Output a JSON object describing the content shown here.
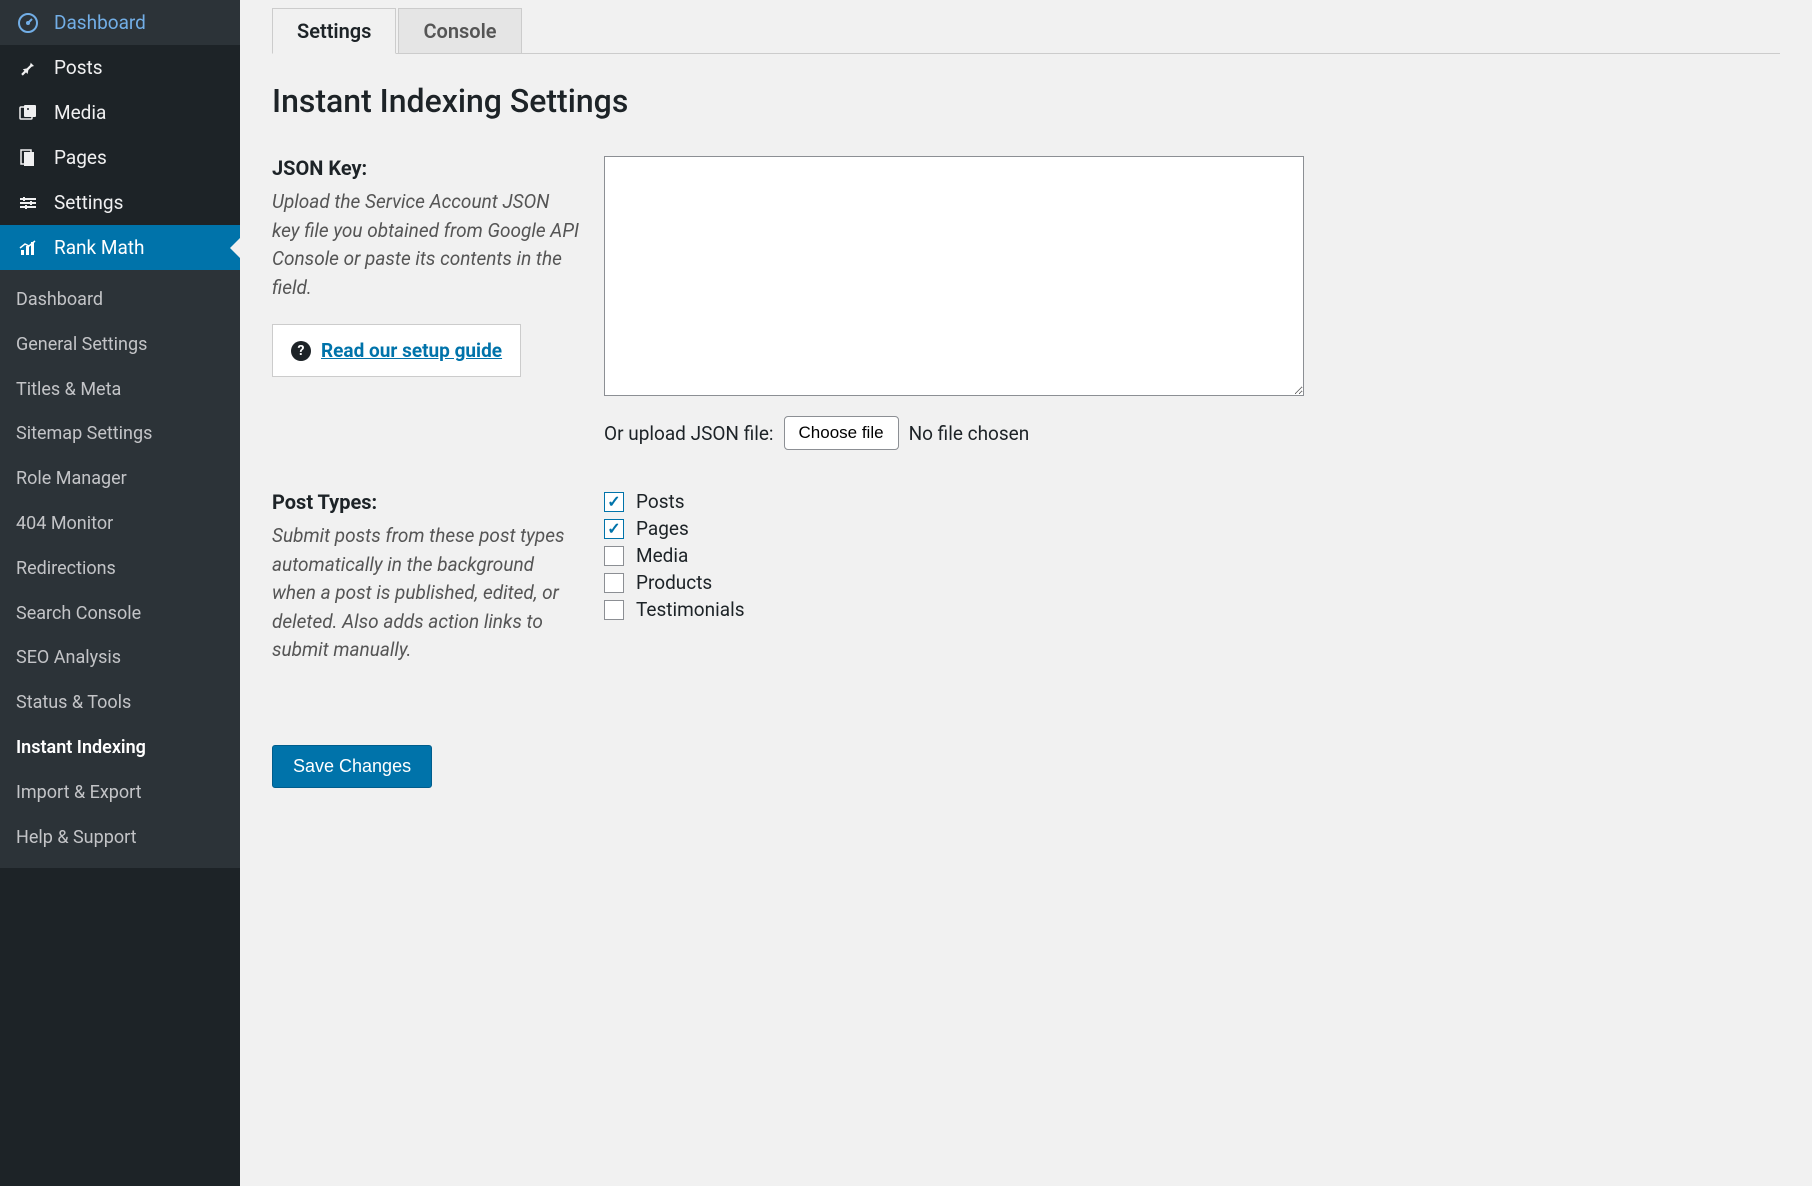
{
  "sidebar": {
    "items": [
      {
        "label": "Dashboard",
        "icon": "dashboard"
      },
      {
        "label": "Posts",
        "icon": "pin"
      },
      {
        "label": "Media",
        "icon": "media"
      },
      {
        "label": "Pages",
        "icon": "page"
      },
      {
        "label": "Settings",
        "icon": "settings"
      },
      {
        "label": "Rank Math",
        "icon": "chart"
      }
    ],
    "submenu": [
      "Dashboard",
      "General Settings",
      "Titles & Meta",
      "Sitemap Settings",
      "Role Manager",
      "404 Monitor",
      "Redirections",
      "Search Console",
      "SEO Analysis",
      "Status & Tools",
      "Instant Indexing",
      "Import & Export",
      "Help & Support"
    ]
  },
  "tabs": [
    "Settings",
    "Console"
  ],
  "page": {
    "title": "Instant Indexing Settings"
  },
  "json_key": {
    "label": "JSON Key:",
    "desc": "Upload the Service Account JSON key file you obtained from Google API Console or paste its contents in the field.",
    "help_link": "Read our setup guide",
    "upload_label": "Or upload JSON file:",
    "choose_btn": "Choose file",
    "file_status": "No file chosen",
    "textarea_value": ""
  },
  "post_types": {
    "label": "Post Types:",
    "desc": "Submit posts from these post types automatically in the background when a post is published, edited, or deleted. Also adds action links to submit manually.",
    "options": [
      {
        "label": "Posts",
        "checked": true
      },
      {
        "label": "Pages",
        "checked": true
      },
      {
        "label": "Media",
        "checked": false
      },
      {
        "label": "Products",
        "checked": false
      },
      {
        "label": "Testimonials",
        "checked": false
      }
    ]
  },
  "save_button": "Save Changes"
}
